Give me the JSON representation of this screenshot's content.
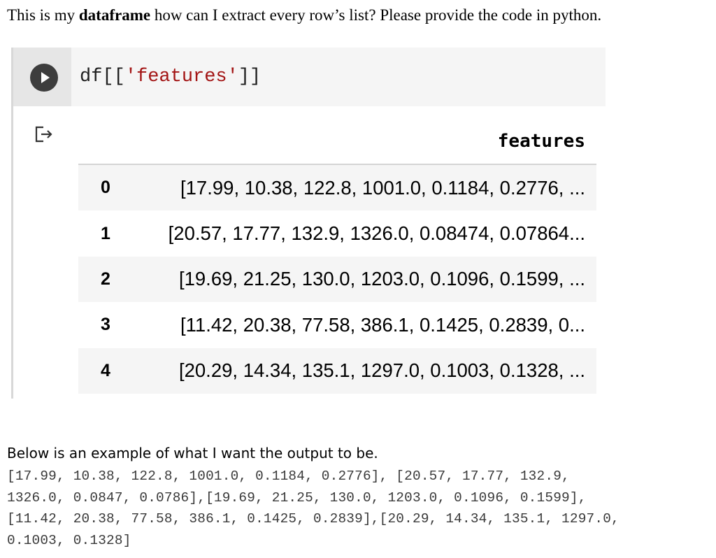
{
  "question": {
    "before": "This is my ",
    "bold": "dataframe",
    "after": " how can I extract every row’s list? Please provide the code in python."
  },
  "cell": {
    "code_prefix": "df[[",
    "code_string": "'features'",
    "code_suffix": "]]",
    "run_icon": "play-icon",
    "output_icon": "output-redirect-icon"
  },
  "table": {
    "column_header": "features",
    "rows": [
      {
        "index": "0",
        "value": "[17.99, 10.38, 122.8, 1001.0, 0.1184, 0.2776, ..."
      },
      {
        "index": "1",
        "value": "[20.57, 17.77, 132.9, 1326.0, 0.08474, 0.07864..."
      },
      {
        "index": "2",
        "value": "[19.69, 21.25, 130.0, 1203.0, 0.1096, 0.1599, ..."
      },
      {
        "index": "3",
        "value": "[11.42, 20.38, 77.58, 386.1, 0.1425, 0.2839, 0..."
      },
      {
        "index": "4",
        "value": "[20.29, 14.34, 135.1, 1297.0, 0.1003, 0.1328, ..."
      }
    ]
  },
  "explanation": "Below is an example of what I want the output to be.",
  "example_lines": [
    "[17.99, 10.38, 122.8, 1001.0, 0.1184, 0.2776], [20.57, 17.77, 132.9,",
    "1326.0, 0.0847, 0.0786],[19.69, 21.25, 130.0, 1203.0, 0.1096, 0.1599],",
    "[11.42, 20.38, 77.58, 386.1, 0.1425, 0.2839],[20.29, 14.34, 135.1, 1297.0,",
    "0.1003, 0.1328]"
  ],
  "colors": {
    "code_string": "#a31515",
    "run_button": "#3d3d3d",
    "cell_gutter": "#e6e6e6",
    "row_stripe": "#f5f5f5"
  }
}
